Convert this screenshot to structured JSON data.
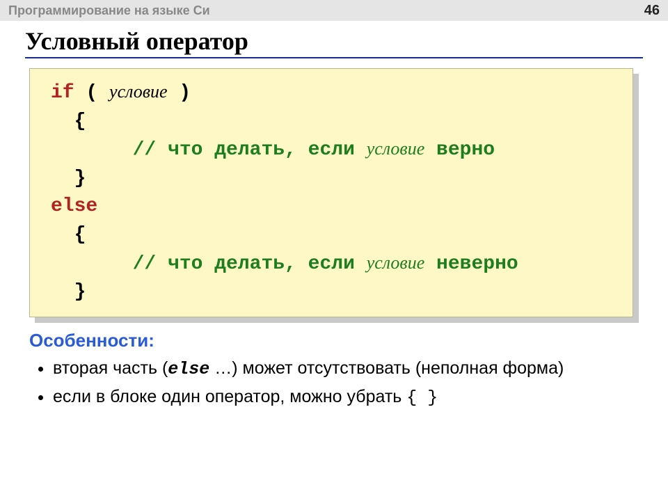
{
  "header": {
    "breadcrumb": "Программирование на языке Си",
    "page_number": "46"
  },
  "title": "Условный оператор",
  "code": {
    "if_keyword": "if",
    "else_keyword": "else",
    "open_paren": " ( ",
    "close_paren": " )",
    "condition_word": "условие",
    "open_brace": "  {",
    "close_brace": "  }",
    "comment_true_pre": "       // что делать, если ",
    "comment_true_post": " верно",
    "comment_false_pre": "       // что делать, если ",
    "comment_false_post": " неверно"
  },
  "section_label": "Особенности:",
  "bullets": {
    "b1_pre": "вторая часть (",
    "b1_else": "else",
    "b1_post": " …) может отсутствовать (неполная форма)",
    "b2_pre": "если в блоке один оператор, можно убрать ",
    "b2_braces": "{ }"
  }
}
